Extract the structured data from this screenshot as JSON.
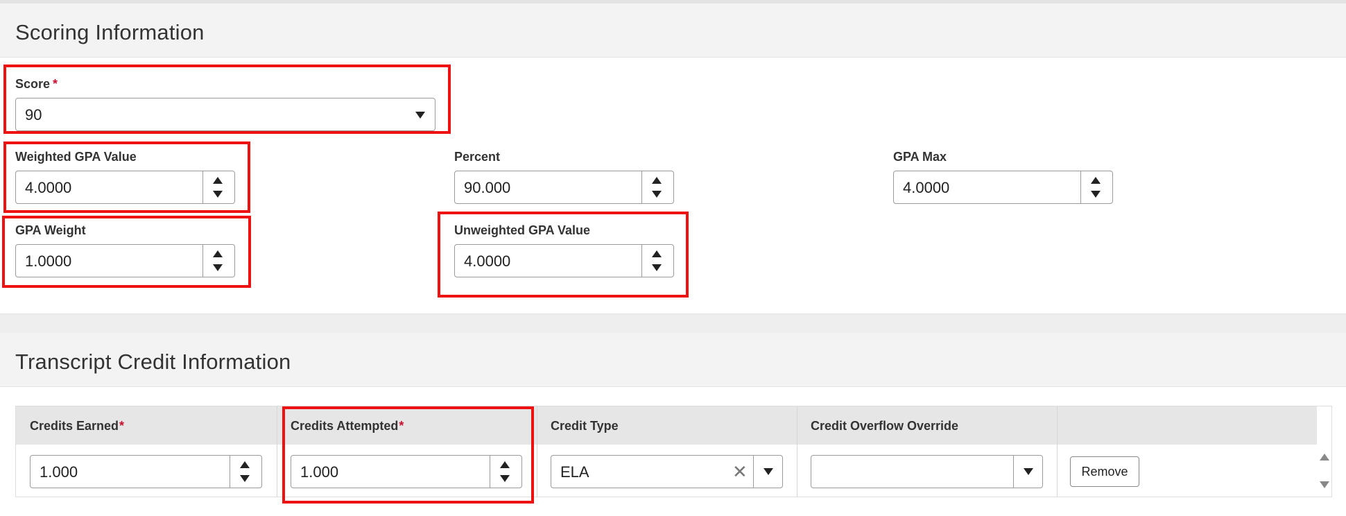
{
  "scoring": {
    "title": "Scoring Information",
    "score": {
      "label": "Score",
      "required_mark": "*",
      "value": "90"
    },
    "weighted_gpa_value": {
      "label": "Weighted GPA Value",
      "value": "4.0000"
    },
    "percent": {
      "label": "Percent",
      "value": "90.000"
    },
    "gpa_max": {
      "label": "GPA Max",
      "value": "4.0000"
    },
    "gpa_weight": {
      "label": "GPA Weight",
      "value": "1.0000"
    },
    "unweighted_gpa_value": {
      "label": "Unweighted GPA Value",
      "value": "4.0000"
    }
  },
  "transcript": {
    "title": "Transcript Credit Information",
    "columns": {
      "credits_earned": "Credits Earned",
      "credits_attempted": "Credits Attempted",
      "credit_type": "Credit Type",
      "credit_overflow_override": "Credit Overflow Override",
      "required_mark": "*"
    },
    "row": {
      "credits_earned": "1.000",
      "credits_attempted": "1.000",
      "credit_type": "ELA",
      "credit_overflow_override": "",
      "remove_label": "Remove",
      "clear_glyph": "✕"
    }
  },
  "colors": {
    "highlight": "#ee1111",
    "required": "#c8102e",
    "header_bg": "#f3f3f3",
    "table_header_bg": "#e6e6e6"
  }
}
